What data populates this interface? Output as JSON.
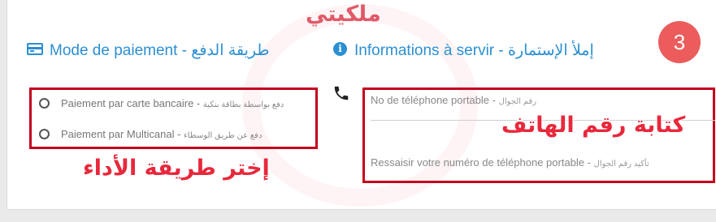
{
  "watermark": "ملكيتي",
  "step": {
    "number": "3"
  },
  "payment": {
    "title": "Mode de paiement - طريقة الدفع",
    "options": [
      {
        "label": "Paiement par carte bancaire - ",
        "label_ar": "دفع بواسطة بطاقة بنكية",
        "selected": false
      },
      {
        "label": "Paiement par Multicanal - ",
        "label_ar": "دفع عن طريق الوسطاء",
        "selected": false
      }
    ]
  },
  "info": {
    "title": "Informations à servir - إملأ الإستمارة",
    "phone_label": "No de téléphone portable - ",
    "phone_label_ar": "رقم الجوال",
    "phone_value": "",
    "confirm_label": "Ressaisir votre numéro de téléphone portable - ",
    "confirm_label_ar": "تأكيد رقم الجوال",
    "confirm_value": ""
  },
  "annotations": {
    "choose_payment": "إختر طريقة الأداء",
    "write_phone": "كتابة رقم الهاتف"
  },
  "colors": {
    "accent": "#2b8fd3",
    "badge": "#ec5c5c",
    "annotation": "#e8283c",
    "highlight_box": "#c4001d"
  },
  "icons": [
    "credit-card-icon",
    "info-icon",
    "phone-icon"
  ]
}
